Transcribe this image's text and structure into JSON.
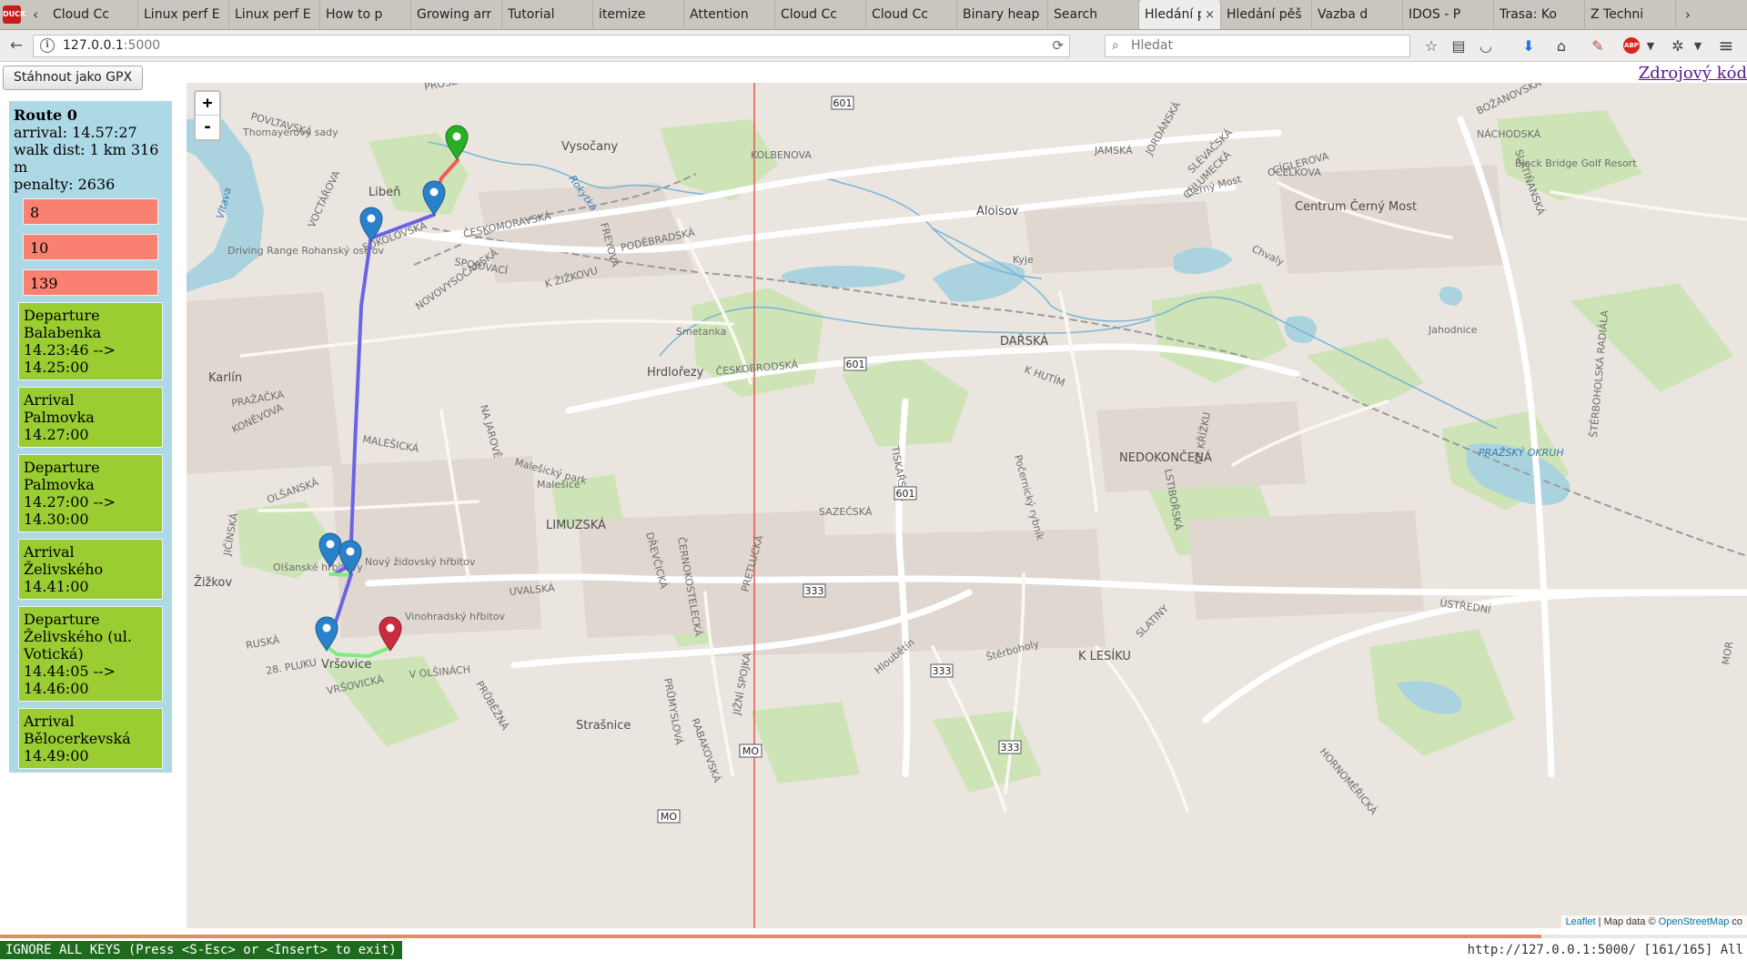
{
  "browser": {
    "tabs": [
      {
        "label": "Cloud Cc",
        "fav": "#2b8fd6"
      },
      {
        "label": "Linux perf E",
        "fav": ""
      },
      {
        "label": "Linux perf E",
        "fav": ""
      },
      {
        "label": "How to p",
        "fav": "#3d6fb5"
      },
      {
        "label": "Growing arr",
        "fav": ""
      },
      {
        "label": "Tutorial",
        "fav": "#e1a93a"
      },
      {
        "label": "itemize",
        "fav": "#b22222"
      },
      {
        "label": "Attention",
        "fav": ""
      },
      {
        "label": "Cloud Cc",
        "fav": "#2b8fd6"
      },
      {
        "label": "Cloud Cc",
        "fav": "#2b8fd6"
      },
      {
        "label": "Binary heap",
        "fav": ""
      },
      {
        "label": "Search",
        "fav": "#333333"
      },
      {
        "label": "Hledání pěš",
        "fav": ""
      },
      {
        "label": "Vazba d",
        "fav": "#c0392b"
      },
      {
        "label": "IDOS - P",
        "fav": "#2d62a8"
      },
      {
        "label": "Trasa: Ko",
        "fav": "#3b9c3b"
      },
      {
        "label": "Z Techni",
        "fav": "#4285f4"
      }
    ],
    "active_tab": {
      "label": "Hledání p",
      "close": "×"
    },
    "url_host": "127.0.0.1",
    "url_port": ":5000",
    "search_placeholder": "Hledat",
    "icons": {
      "back": "←",
      "reload": "⟳",
      "search": "🔍",
      "bookmark": "☆",
      "menu": "≡"
    }
  },
  "page": {
    "gpx_button": "Stáhnout jako GPX",
    "source_link": "Zdrojový kód"
  },
  "route": {
    "title": "Route 0",
    "arrival": "arrival: 14.57:27",
    "walk_dist": "walk dist: 1 km 316 m",
    "penalty": "penalty: 2636",
    "penalties": [
      "8",
      "10",
      "139"
    ],
    "steps": [
      {
        "lines": [
          "Departure",
          "Balabenka",
          "14.23:46 -->",
          "14.25:00"
        ]
      },
      {
        "lines": [
          "Arrival",
          "Palmovka",
          "14.27:00"
        ]
      },
      {
        "lines": [
          "Departure",
          "Palmovka",
          "14.27:00 -->",
          "14.30:00"
        ]
      },
      {
        "lines": [
          "Arrival",
          "Želivského",
          "14.41:00"
        ]
      },
      {
        "lines": [
          "Departure",
          "Želivského (ul.",
          "Votická)",
          "14.44:05 -->",
          "14.46:00"
        ]
      },
      {
        "lines": [
          "Arrival",
          "Bělocerkevská",
          "14.49:00"
        ]
      }
    ]
  },
  "map": {
    "zoom_in": "+",
    "zoom_out": "-",
    "attribution": {
      "leaflet": "Leaflet",
      "mid": " | Map data © ",
      "osm": "OpenStreetMap",
      "tail": " co"
    },
    "colors": {
      "transit": "#6b63e6",
      "walk": "#7dee7d",
      "walk_start": "#f05a5a",
      "marker_blue": "#2a81cb",
      "marker_green": "#2aad27",
      "marker_red": "#cb2b3e",
      "meridian": "#e8403a"
    },
    "labels": [
      {
        "text": "PROSE"
      },
      {
        "text": "POVLTAVSKÁ"
      },
      {
        "text": "Thomayerovy sady"
      },
      {
        "text": "Vltava"
      },
      {
        "text": "Libeň"
      },
      {
        "text": "VOCTÁŘOVA"
      },
      {
        "text": "SOKOLOVSKÁ"
      },
      {
        "text": "ČESKOMORAVSKÁ"
      },
      {
        "text": "Driving Range Rohanský ostrov"
      },
      {
        "text": "SPOJOVACÍ"
      },
      {
        "text": "NOVOVYSOČANSKÁ"
      },
      {
        "text": "K ŽIŽKOVU"
      },
      {
        "text": "Vysočany"
      },
      {
        "text": "Rokytka"
      },
      {
        "text": "FREYOVA"
      },
      {
        "text": "KOLBENOVA"
      },
      {
        "text": "PODĚBRADSKÁ"
      },
      {
        "text": "Karlín"
      },
      {
        "text": "PRAŽAČKA"
      },
      {
        "text": "KONĚVOVA"
      },
      {
        "text": "MALEŠICKÁ"
      },
      {
        "text": "OLŠANSKÁ"
      },
      {
        "text": "JIČÍNSKÁ"
      },
      {
        "text": "Žižkov"
      },
      {
        "text": "Olšanské hřbitovy"
      },
      {
        "text": "Nový židovský hřbitov"
      },
      {
        "text": "Vinohradský hřbitov"
      },
      {
        "text": "RUSKÁ"
      },
      {
        "text": "28. PLUKU"
      },
      {
        "text": "Vršovice"
      },
      {
        "text": "VRŠOVICKÁ"
      },
      {
        "text": "V OLŠINÁCH"
      },
      {
        "text": "PRŮBĚŽNÁ"
      },
      {
        "text": "Strašnice"
      },
      {
        "text": "Hrdlořezy"
      },
      {
        "text": "Smetanka"
      },
      {
        "text": "ČESKOBRODSKÁ"
      },
      {
        "text": "NA JAROVĚ"
      },
      {
        "text": "Malešický park"
      },
      {
        "text": "Malešice"
      },
      {
        "text": "LIMUZSKÁ"
      },
      {
        "text": "DŘEVČICKÁ"
      },
      {
        "text": "ČERNOKOSTELECKÁ"
      },
      {
        "text": "UVALSKÁ"
      },
      {
        "text": "PRŮMYSLOVÁ"
      },
      {
        "text": "TISKAŘSKÁ"
      },
      {
        "text": "SAZEČSKÁ"
      },
      {
        "text": "PRETLUCKÁ"
      },
      {
        "text": "RABAKOVSKÁ"
      },
      {
        "text": "JIŽNÍ SPOJKA"
      },
      {
        "text": "Hloubětín"
      },
      {
        "text": "Aloisov"
      },
      {
        "text": "Kyje"
      },
      {
        "text": "DAŘSKÁ"
      },
      {
        "text": "K HUTÍM"
      },
      {
        "text": "JAMSKÁ"
      },
      {
        "text": "JORDÁNSKÁ"
      },
      {
        "text": "SLÉVAČSKÁ"
      },
      {
        "text": "CHLUMECKÁ"
      },
      {
        "text": "CÍGLEROVA"
      },
      {
        "text": "Černý Most"
      },
      {
        "text": "Centrum Černý Most"
      },
      {
        "text": "OCELKOVA"
      },
      {
        "text": "Chvaly"
      },
      {
        "text": "NÁCHODSKÁ"
      },
      {
        "text": "BOŽANOVSKÁ"
      },
      {
        "text": "SLATIŇANSKÁ"
      },
      {
        "text": "Black Bridge Golf Resort"
      },
      {
        "text": "Jahodnice"
      },
      {
        "text": "NEDOKONČENÁ"
      },
      {
        "text": "Počernický rybník"
      },
      {
        "text": "PRAŽSKÝ OKRUH"
      },
      {
        "text": "ŠTĚRBOHOLSKÁ RADIÁLA"
      },
      {
        "text": "ÚSTŘEDNÍ"
      },
      {
        "text": "Štěrboholy"
      },
      {
        "text": "K LESÍKU"
      },
      {
        "text": "SLATINY"
      },
      {
        "text": "HORNOMĚŘICKÁ"
      },
      {
        "text": "LSTIBOŘSKÁ"
      },
      {
        "text": "KE KŘÍŽKU"
      },
      {
        "text": "MOR"
      }
    ],
    "shields": [
      "601",
      "601",
      "601",
      "333",
      "333",
      "333",
      "MO",
      "MO"
    ]
  },
  "statusbar": {
    "mode": "IGNORE ALL KEYS (Press <S-Esc> or <Insert> to exit)",
    "url": "http://127.0.0.1:5000/ [161/165] All"
  }
}
